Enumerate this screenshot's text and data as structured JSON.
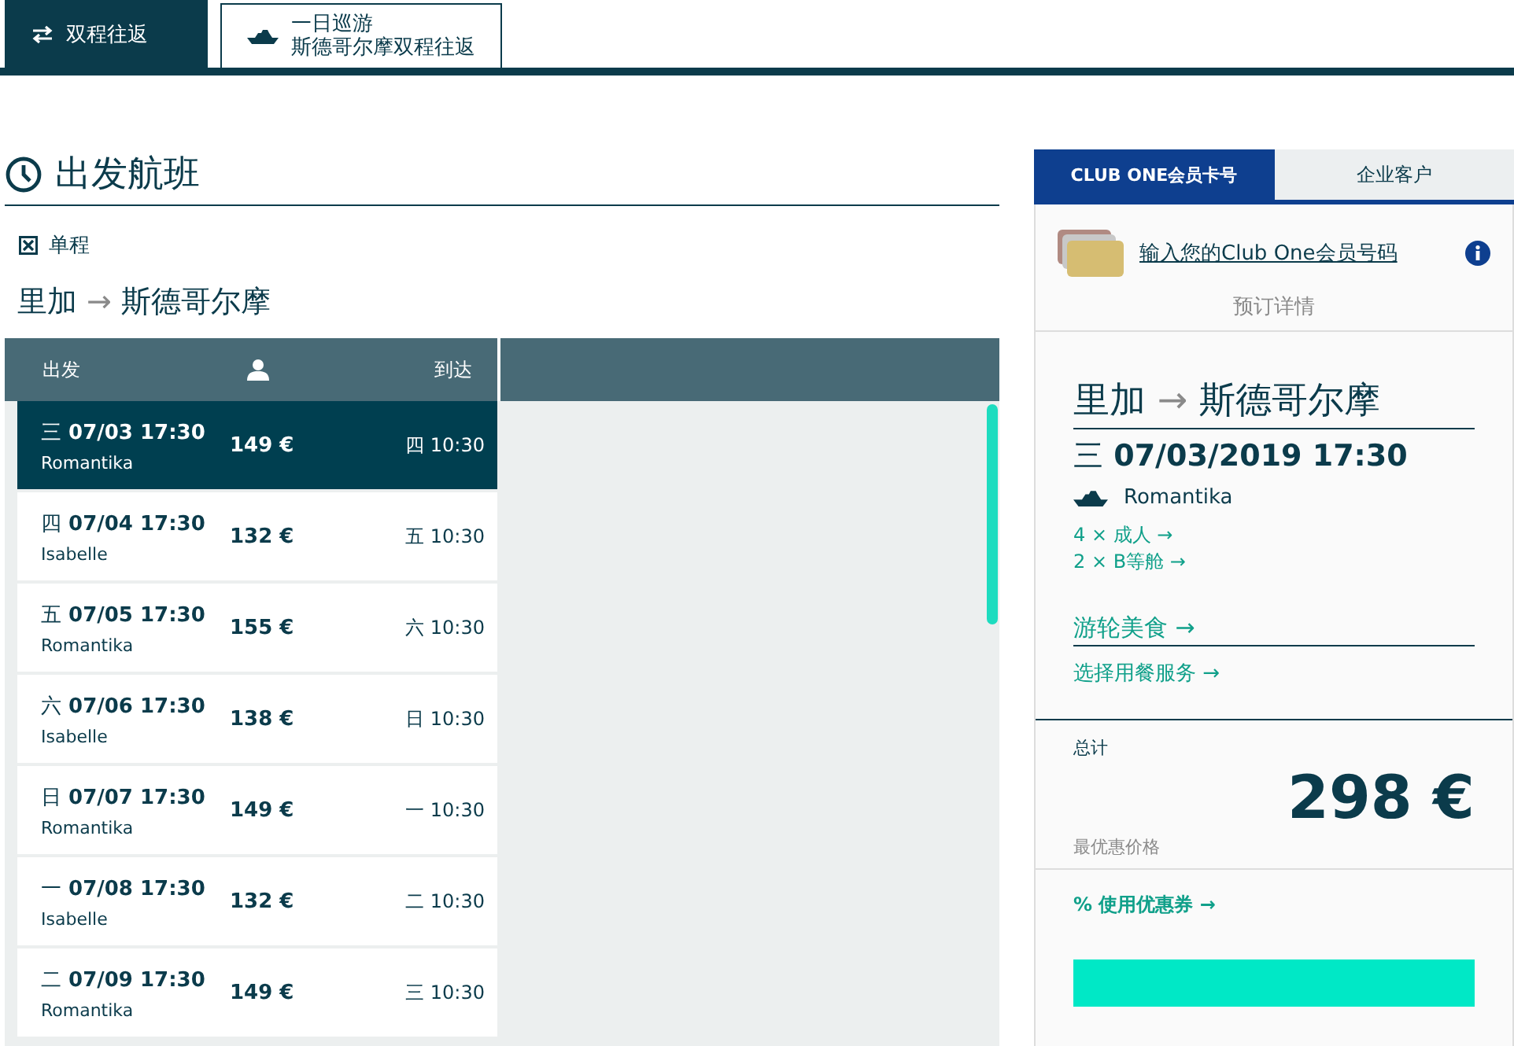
{
  "top_tabs": [
    {
      "kind": "swap",
      "label": "双程往返",
      "selected": true
    },
    {
      "kind": "ship",
      "label": "一日巡游",
      "sublabel": "斯德哥尔摩双程往返",
      "selected": false
    }
  ],
  "section": {
    "title": "出发航班"
  },
  "one_way": {
    "label": "单程",
    "checked": true
  },
  "route": {
    "from": "里加",
    "arrow": "→",
    "to": "斯德哥尔摩"
  },
  "table": {
    "columns": [
      "出发",
      "到达"
    ],
    "rows": [
      {
        "day": "三",
        "date": "07/03 17:30",
        "ship": "Romantika",
        "price": "149 €",
        "arrival": "四 10:30",
        "selected": true
      },
      {
        "day": "四",
        "date": "07/04 17:30",
        "ship": "Isabelle",
        "price": "132 €",
        "arrival": "五 10:30",
        "selected": false
      },
      {
        "day": "五",
        "date": "07/05 17:30",
        "ship": "Romantika",
        "price": "155 €",
        "arrival": "六 10:30",
        "selected": false
      },
      {
        "day": "六",
        "date": "07/06 17:30",
        "ship": "Isabelle",
        "price": "138 €",
        "arrival": "日 10:30",
        "selected": false
      },
      {
        "day": "日",
        "date": "07/07 17:30",
        "ship": "Romantika",
        "price": "149 €",
        "arrival": "一 10:30",
        "selected": false
      },
      {
        "day": "一",
        "date": "07/08 17:30",
        "ship": "Isabelle",
        "price": "132 €",
        "arrival": "二 10:30",
        "selected": false
      },
      {
        "day": "二",
        "date": "07/09 17:30",
        "ship": "Romantika",
        "price": "149 €",
        "arrival": "三 10:30",
        "selected": false
      }
    ]
  },
  "side_tabs": [
    {
      "label": "CLUB ONE会员卡号",
      "selected": true
    },
    {
      "label": "企业客户",
      "selected": false
    }
  ],
  "club_link": "输入您的Club One会员号码",
  "booking": {
    "heading": "预订详情",
    "route": {
      "from": "里加",
      "arrow": "→",
      "to": "斯德哥尔摩"
    },
    "day": "三",
    "datetime": "07/03/2019 17:30",
    "ship": "Romantika",
    "links": [
      "4 × 成人 →",
      "2 × B等舱 →"
    ],
    "dining_title": "游轮美食 →",
    "dining_link": "选择用餐服务 →"
  },
  "total": {
    "label": "总计",
    "amount": "298 €",
    "note": "最优惠价格"
  },
  "coupon": "% 使用优惠券 →"
}
